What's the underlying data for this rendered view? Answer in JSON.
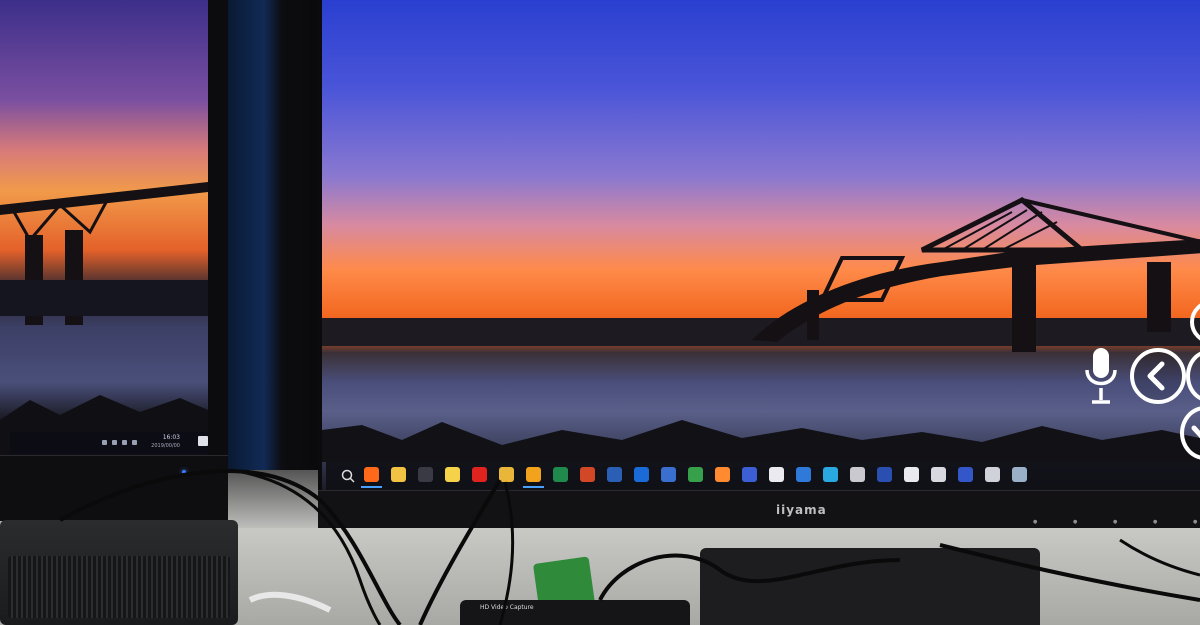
{
  "left_monitor": {
    "clock_time": "16:03",
    "clock_date": "2019/00/00"
  },
  "main_monitor": {
    "brand": "iiyama",
    "taskbar_icons": [
      {
        "name": "search-icon",
        "color": "#ff6a1a"
      },
      {
        "name": "file-explorer-icon",
        "color": "#f2c242"
      },
      {
        "name": "terminal-icon",
        "color": "#3a3a44"
      },
      {
        "name": "notes-icon",
        "color": "#f6d24a"
      },
      {
        "name": "opera-icon",
        "color": "#e0231f"
      },
      {
        "name": "chrome-icon",
        "color": "#e9b63a"
      },
      {
        "name": "chrome-canary-icon",
        "color": "#f3a21b"
      },
      {
        "name": "excel-icon",
        "color": "#1f8a4c"
      },
      {
        "name": "powerpoint-icon",
        "color": "#d24726"
      },
      {
        "name": "word-icon",
        "color": "#2b5fb5"
      },
      {
        "name": "outlook-icon",
        "color": "#1a6ad8"
      },
      {
        "name": "app-icon-1",
        "color": "#3a6fd0"
      },
      {
        "name": "app-icon-2",
        "color": "#36a14a"
      },
      {
        "name": "app-icon-3",
        "color": "#ff8a30"
      },
      {
        "name": "app-icon-4",
        "color": "#3c5fd6"
      },
      {
        "name": "app-icon-5",
        "color": "#eaeaf0"
      },
      {
        "name": "app-icon-6",
        "color": "#2f79d8"
      },
      {
        "name": "app-icon-7",
        "color": "#2aa8e0"
      },
      {
        "name": "app-icon-8",
        "color": "#c9c9cf"
      },
      {
        "name": "ru-icon",
        "color": "#2a4fb0"
      },
      {
        "name": "app-icon-9",
        "color": "#e9e9ef"
      },
      {
        "name": "app-icon-10",
        "color": "#d8d8e0"
      },
      {
        "name": "v-icon",
        "color": "#3356c8"
      },
      {
        "name": "app-icon-11",
        "color": "#cfd2d8"
      },
      {
        "name": "app-icon-12",
        "color": "#9ab0c8"
      }
    ]
  },
  "capture_device": {
    "label": "HD Video Capture"
  }
}
